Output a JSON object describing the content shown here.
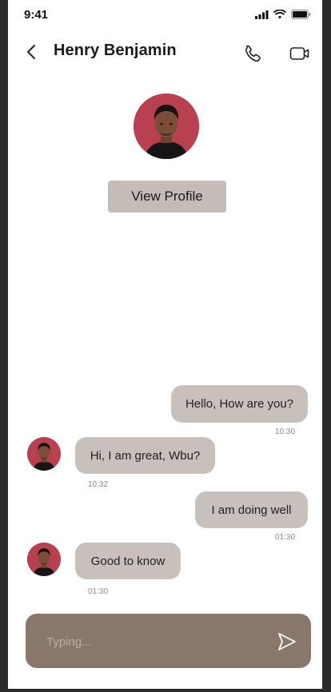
{
  "status_bar": {
    "time": "9:41"
  },
  "header": {
    "title": "Henry Benjamin",
    "back_icon": "chevron-left-icon",
    "call_icon": "phone-icon",
    "video_icon": "video-icon"
  },
  "profile": {
    "view_profile_label": "View Profile"
  },
  "messages": [
    {
      "side": "outgoing",
      "text": "Hello, How are you?",
      "time": "10:30"
    },
    {
      "side": "incoming",
      "text": "Hi, I am great, Wbu?",
      "time": "10:32"
    },
    {
      "side": "outgoing",
      "text": "I am doing well",
      "time": "01:30"
    },
    {
      "side": "incoming",
      "text": "Good to know",
      "time": "01:30"
    }
  ],
  "composer": {
    "placeholder": "Typing...",
    "send_icon": "send-icon"
  },
  "colors": {
    "bubble": "#c8c0ba",
    "button": "#c4bcb6",
    "composer": "#8a776c",
    "avatar_bg": "#b8404f"
  }
}
